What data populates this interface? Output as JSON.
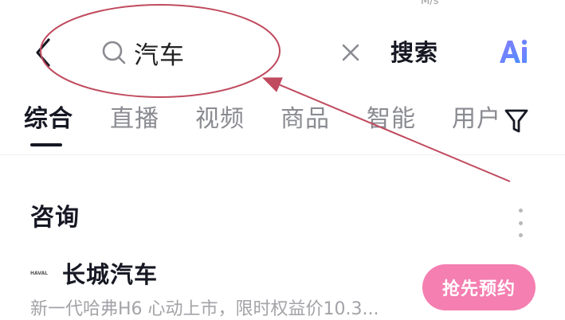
{
  "status_remnant": "M/s",
  "header": {
    "query": "汽车",
    "search_label": "搜索",
    "ai_label": "Ai"
  },
  "tabs": [
    {
      "label": "综合",
      "active": true
    },
    {
      "label": "直播",
      "active": false
    },
    {
      "label": "视频",
      "active": false
    },
    {
      "label": "商品",
      "active": false
    },
    {
      "label": "智能",
      "active": false
    },
    {
      "label": "用户",
      "active": false
    }
  ],
  "section": {
    "title": "咨询",
    "ad": {
      "logo_text": "HAVAL",
      "brand": "长城汽车",
      "description": "新一代哈弗H6 心动上市，限时权益价10.3...",
      "cta": "抢先预约"
    }
  },
  "colors": {
    "accent_pink": "#f47fb0",
    "annotation_red": "#c04a5e",
    "ai_gradient_start": "#8a7bff",
    "ai_gradient_end": "#4f8dff"
  },
  "icons": [
    "back-arrow-icon",
    "search-icon",
    "close-icon",
    "ai-icon",
    "filter-icon",
    "more-vertical-icon"
  ]
}
